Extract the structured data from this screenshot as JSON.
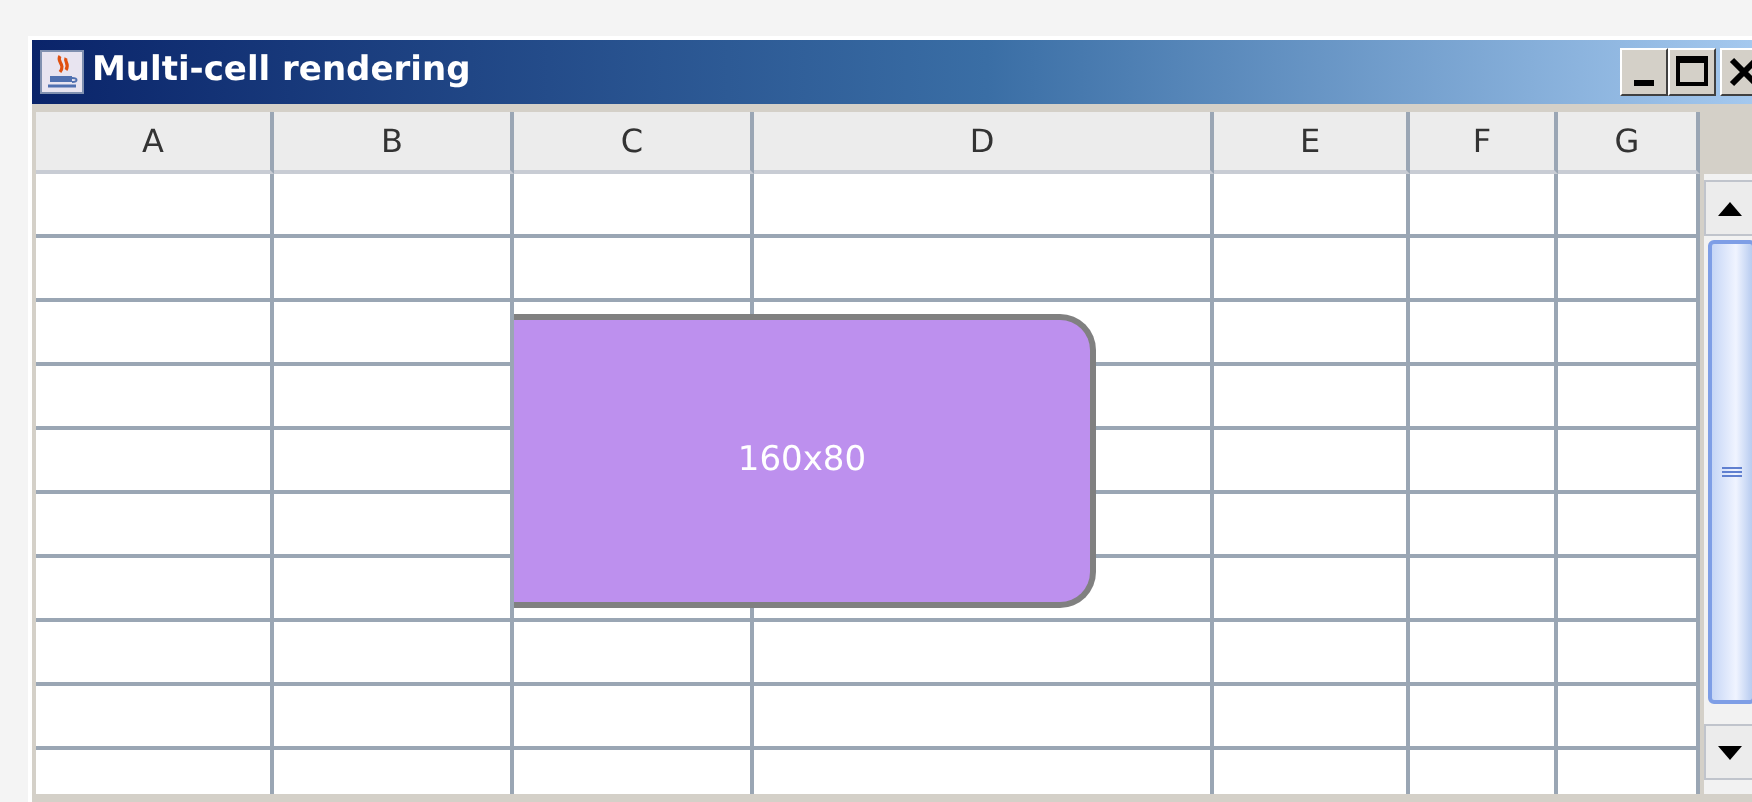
{
  "window": {
    "title": "Multi-cell rendering"
  },
  "table": {
    "columns": [
      "A",
      "B",
      "C",
      "D",
      "E",
      "F",
      "G"
    ]
  },
  "cell_shape": {
    "label": "160x80"
  }
}
